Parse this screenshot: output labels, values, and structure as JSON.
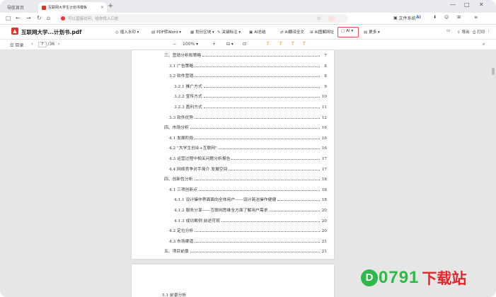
{
  "browser": {
    "tabs": [
      {
        "label": "导航首页",
        "active": false
      },
      {
        "label": "互联网大学生计划书模板",
        "active": true
      }
    ],
    "window_controls": [
      "—",
      "□",
      "✕"
    ],
    "omnibox_placeholder": "可以直接访问，给你找入口处",
    "right_items": {
      "mode": "文件系统",
      "ai": "AI"
    }
  },
  "app_toolbar": {
    "title": "互联网大学...计划书.pdf",
    "items": [
      "插入水印",
      "PDF转Word",
      "划分区块",
      "关键标注",
      "AI总结",
      "AI翻译全文",
      "AI图解网址",
      "AI",
      "更多"
    ],
    "right": [
      "导出",
      "打印"
    ]
  },
  "view_toolbar": {
    "outline": "目录",
    "page_current": "7",
    "page_total": "/36",
    "zoom": "100%"
  },
  "toc": [
    {
      "text": "三、营销分析和策略",
      "page": "7",
      "indent": 0
    },
    {
      "text": "3.1 广告策略",
      "page": "8",
      "indent": 1
    },
    {
      "text": "3.2 软件营销",
      "page": "8",
      "indent": 1
    },
    {
      "text": "3.2.1 推广方式",
      "page": "9",
      "indent": 2
    },
    {
      "text": "3.2.2 宣传方式",
      "page": "10",
      "indent": 2
    },
    {
      "text": "3.2.3 盈利方式",
      "page": "11",
      "indent": 2
    },
    {
      "text": "3.3 软件优势",
      "page": "12",
      "indent": 1
    },
    {
      "text": "四、市场分析",
      "page": "16",
      "indent": 0
    },
    {
      "text": "4.1 发展阶段",
      "page": "16",
      "indent": 1
    },
    {
      "text": "4.2 \"大学生创业+互联网\"",
      "page": "16",
      "indent": 1
    },
    {
      "text": "4.3 运营过程中相关问题分析报告",
      "page": "17",
      "indent": 1
    },
    {
      "text": "4.4 网络竞争对手简介    发展空间",
      "page": "17",
      "indent": 1
    },
    {
      "text": "四、创新性分析",
      "page": "18",
      "indent": 0
    },
    {
      "text": "4.1 三项创新点",
      "page": "18",
      "indent": 1
    },
    {
      "text": "4.1.1 设计操作界面面向全体用户——设计简洁操作便捷",
      "page": "18",
      "indent": 2
    },
    {
      "text": "4.1.2 服务分享——互联网思维全方面了解用户需求",
      "page": "20",
      "indent": 2
    },
    {
      "text": "4.1.3 成功案例    前途可观",
      "page": "20",
      "indent": 2
    },
    {
      "text": "4.2 定位分析",
      "page": "20",
      "indent": 1
    },
    {
      "text": "4.3 市场渠道",
      "page": "21",
      "indent": 1
    },
    {
      "text": "五、项目前景",
      "page": "21",
      "indent": 0
    }
  ],
  "page2_first_line": "5.1 前景分析",
  "watermark": {
    "circle": "D",
    "num": "0791",
    "cn": "下载站"
  }
}
